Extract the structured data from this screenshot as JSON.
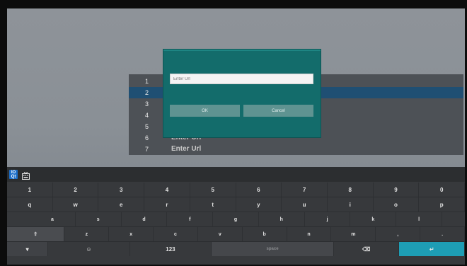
{
  "url_list": {
    "rows": [
      {
        "num": "1",
        "url": ""
      },
      {
        "num": "2",
        "url": ""
      },
      {
        "num": "3",
        "url": ""
      },
      {
        "num": "4",
        "url": ""
      },
      {
        "num": "5",
        "url": ""
      },
      {
        "num": "6",
        "url": "Enter Url"
      },
      {
        "num": "7",
        "url": "Enter Url"
      }
    ],
    "selected_index": 1
  },
  "dialog": {
    "input_placeholder": "Enter Url",
    "ok_label": "OK",
    "cancel_label": "Cancel"
  },
  "keyboard": {
    "lang_icon_text_top": "IO",
    "lang_icon_text_bottom": "Qt",
    "row1": [
      "1",
      "2",
      "3",
      "4",
      "5",
      "6",
      "7",
      "8",
      "9",
      "0"
    ],
    "row2": [
      "q",
      "w",
      "e",
      "r",
      "t",
      "y",
      "u",
      "i",
      "o",
      "p"
    ],
    "row3": [
      "a",
      "s",
      "d",
      "f",
      "g",
      "h",
      "j",
      "k",
      "l"
    ],
    "row4": [
      "z",
      "x",
      "c",
      "v",
      "b",
      "n",
      "m",
      ",",
      "."
    ],
    "shift_glyph": "⇧",
    "mode_label": "123",
    "space_label": "space",
    "emoji_glyph": "☺",
    "menu_glyph": "▾",
    "backspace_glyph": "⌫",
    "enter_glyph": "↵"
  },
  "colors": {
    "dialog_bg": "#136c6b",
    "selected_row": "#1f4f73",
    "enter_key": "#1e9db4"
  }
}
